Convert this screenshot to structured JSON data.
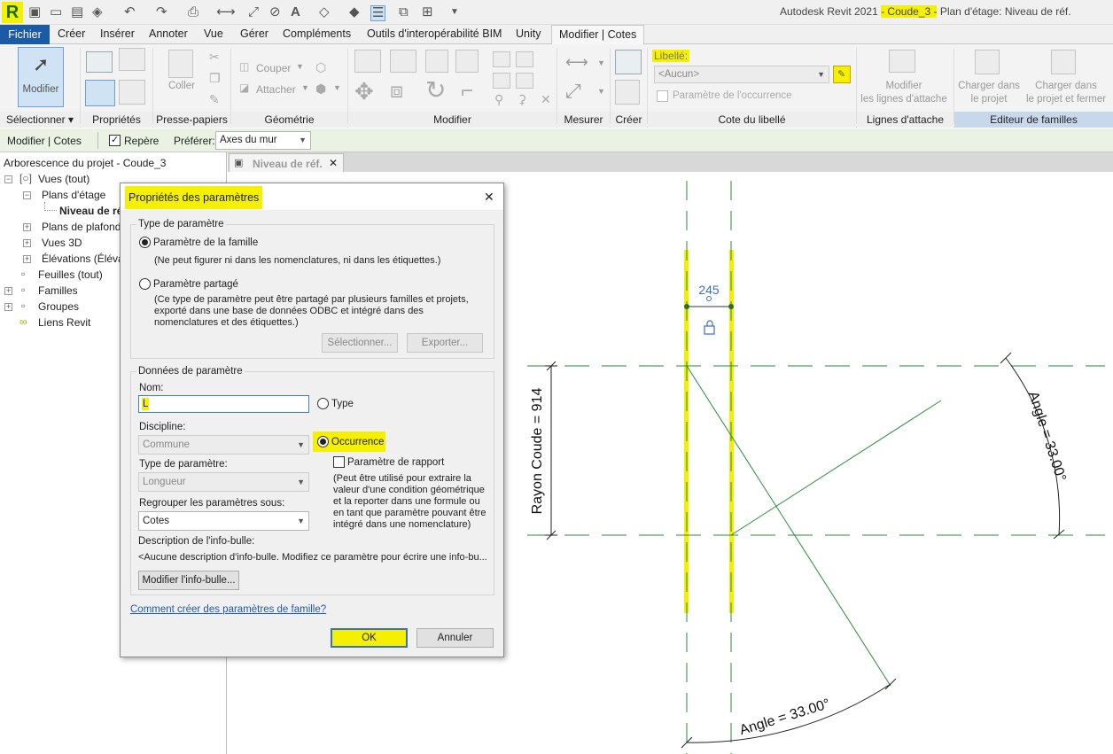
{
  "window": {
    "title_app": "Autodesk Revit 2021",
    "title_project": "- Coude_3 -",
    "title_view": "Plan d'étage: Niveau de réf."
  },
  "app_logo": "R",
  "menu": {
    "items": [
      "Fichier",
      "Créer",
      "Insérer",
      "Annoter",
      "Vue",
      "Gérer",
      "Compléments",
      "Outils d'interopérabilité BIM",
      "Unity",
      "Modifier | Cotes"
    ]
  },
  "ribbon": {
    "panels": [
      "Sélectionner ▾",
      "Propriétés",
      "Presse-papiers",
      "Géométrie",
      "Modifier",
      "Mesurer",
      "Créer",
      "Cote du libellé",
      "Lignes d'attache",
      "Editeur de familles"
    ],
    "modifier_label": "Modifier",
    "coller_label": "Coller",
    "couper_label": "Couper",
    "attacher_label": "Attacher",
    "libelle_label": "Libellé:",
    "libelle_value": "<Aucun>",
    "param_occurrence_label": "Paramètre de l'occurrence",
    "modifier_lignes_1": "Modifier",
    "modifier_lignes_2": "les lignes d'attache",
    "charger_projet_1": "Charger dans",
    "charger_projet_2": "le projet",
    "charger_fermer_1": "Charger dans",
    "charger_fermer_2": "le projet et fermer"
  },
  "options_bar": {
    "context": "Modifier | Cotes",
    "repere_label": "Repère",
    "preferer_label": "Préférer:",
    "preferer_value": "Axes du mur"
  },
  "browser": {
    "title": "Arborescence du projet - Coude_3",
    "items": [
      "Vues (tout)",
      "Plans d'étage",
      "Niveau de réf.",
      "Plans de plafond",
      "Vues 3D",
      "Élévations (Élévat",
      "Feuilles (tout)",
      "Familles",
      "Groupes",
      "Liens Revit"
    ]
  },
  "view_tab": {
    "label": "Niveau de réf.",
    "close": "✕"
  },
  "canvas": {
    "dim_value": "245",
    "radius_label": "Rayon Coude = 914",
    "angle_label": "Angle = 33.00°"
  },
  "dialog": {
    "title": "Propriétés des paramètres",
    "close": "✕",
    "type_group": "Type de paramètre",
    "family_param": "Paramètre de la famille",
    "family_note": "(Ne peut figurer ni dans les nomenclatures, ni dans les étiquettes.)",
    "shared_param": "Paramètre partagé",
    "shared_note": "(Ce type de paramètre peut être partagé par plusieurs familles et projets, exporté dans une base de données ODBC et intégré dans des nomenclatures et des étiquettes.)",
    "select_btn": "Sélectionner...",
    "export_btn": "Exporter...",
    "data_group": "Données de paramètre",
    "name_label": "Nom:",
    "name_value": "L",
    "type_radio": "Type",
    "discipline_label": "Discipline:",
    "discipline_value": "Commune",
    "occurrence_radio": "Occurrence",
    "report_label": "Paramètre de rapport",
    "report_note": "(Peut être utilisé pour extraire la valeur d'une condition géométrique et la reporter dans une formule ou en tant que paramètre pouvant être intégré dans une nomenclature)",
    "param_type_label": "Type de paramètre:",
    "param_type_value": "Longueur",
    "group_label": "Regrouper les paramètres sous:",
    "group_value": "Cotes",
    "tooltip_label": "Description de l'info-bulle:",
    "tooltip_value": "<Aucune description d'info-bulle. Modifiez ce paramètre pour écrire une info-bu...",
    "tooltip_btn": "Modifier l'info-bulle...",
    "help_link": "Comment créer des paramètres de famille?",
    "ok": "OK",
    "cancel": "Annuler"
  },
  "colors": {
    "accent": "#1c5aa6",
    "highlight": "#f5f000",
    "ref_line": "#2a8a3a",
    "wall": "#f2f000"
  }
}
